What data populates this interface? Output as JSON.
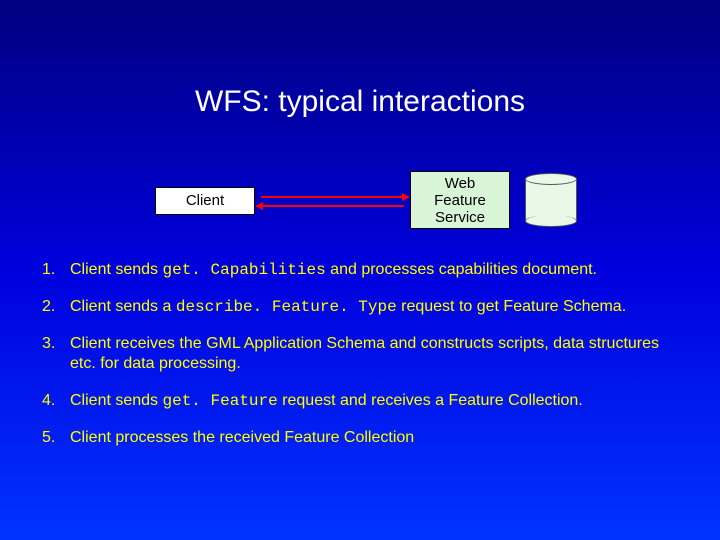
{
  "title": "WFS: typical interactions",
  "diagram": {
    "client_label": "Client",
    "wfs_label_l1": "Web",
    "wfs_label_l2": "Feature",
    "wfs_label_l3": "Service"
  },
  "steps": [
    {
      "num": "1.",
      "pre": "Client sends ",
      "code": "get. Capabilities",
      "post": " and processes capabilities document."
    },
    {
      "num": "2.",
      "pre": "Client sends a ",
      "code": "describe. Feature. Type",
      "post": " request to get Feature Schema."
    },
    {
      "num": "3.",
      "pre": "Client receives the GML Application Schema and constructs scripts, data structures etc. for data processing.",
      "code": "",
      "post": ""
    },
    {
      "num": "4.",
      "pre": "Client sends ",
      "code": "get. Feature",
      "post": " request and receives a Feature Collection."
    },
    {
      "num": "5.",
      "pre": "Client processes the received Feature Collection",
      "code": "",
      "post": ""
    }
  ]
}
